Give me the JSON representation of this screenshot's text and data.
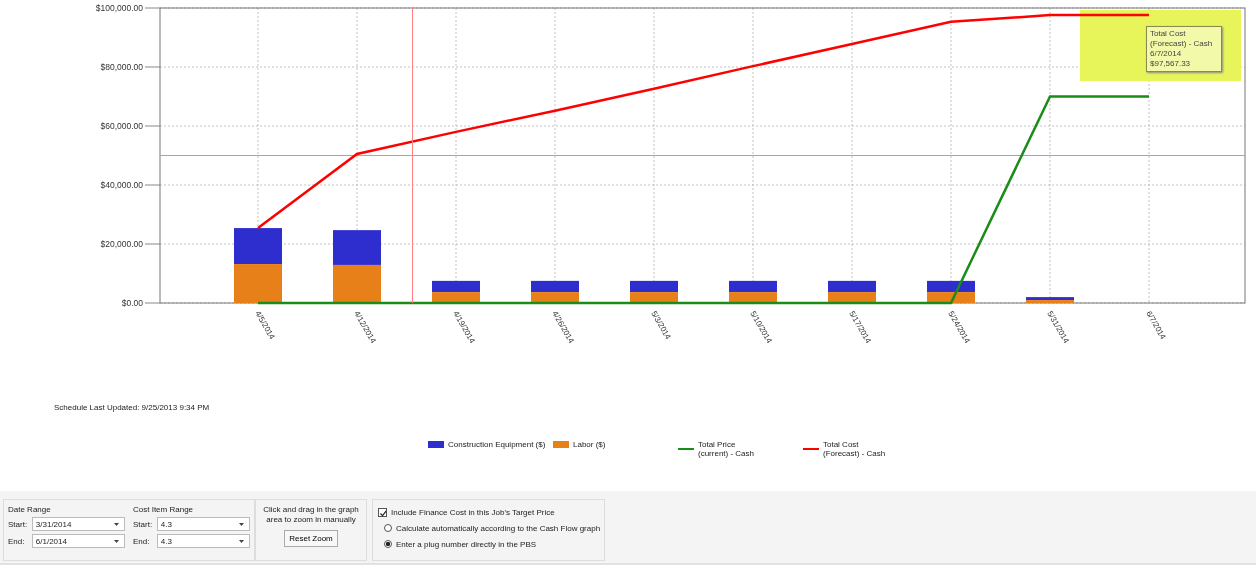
{
  "chart": {
    "chart_data": {
      "type": "bar",
      "stacked": true,
      "categories": [
        "4/5/2014",
        "4/12/2014",
        "4/19/2014",
        "4/26/2014",
        "5/3/2014",
        "5/10/2014",
        "5/17/2014",
        "5/24/2014",
        "5/31/2014",
        "6/7/2014"
      ],
      "ylim": [
        0,
        100000
      ],
      "yticks": [
        {
          "value": 0,
          "label": "$0.00"
        },
        {
          "value": 20000,
          "label": "$20,000.00"
        },
        {
          "value": 40000,
          "label": "$40,000.00"
        },
        {
          "value": 60000,
          "label": "$60,000.00"
        },
        {
          "value": 80000,
          "label": "$80,000.00"
        },
        {
          "value": 100000,
          "label": "$100,000.00"
        }
      ],
      "series": [
        {
          "name": "Construction Equipment ($)",
          "type": "bar",
          "color": "#2e2ecf",
          "values": [
            12200,
            11800,
            3800,
            3800,
            3800,
            3800,
            3800,
            3800,
            1000,
            0
          ]
        },
        {
          "name": "Labor ($)",
          "type": "bar",
          "color": "#e8801a",
          "values": [
            13200,
            12900,
            3700,
            3700,
            3700,
            3700,
            3700,
            3700,
            1000,
            0
          ]
        },
        {
          "name": "Total Price (current) - Cash",
          "type": "line",
          "color": "#1a8c1a",
          "values": [
            0,
            0,
            0,
            0,
            0,
            0,
            0,
            0,
            70000,
            70000
          ]
        },
        {
          "name": "Total Cost (Forecast) - Cash",
          "type": "line",
          "color": "#ff0000",
          "values": [
            25400,
            50500,
            58000,
            65200,
            72600,
            80300,
            87800,
            95300,
            97600,
            97600
          ]
        }
      ],
      "grid": true,
      "ref_lines": [
        {
          "axis": "y",
          "value": 50000
        }
      ]
    },
    "tooltip": {
      "series": "Total Cost (Forecast) - Cash",
      "date": "6/7/2014",
      "value": "$97,567.33"
    }
  },
  "schedule_updated": "Schedule Last Updated: 9/25/2013 9:34 PM",
  "controls": {
    "date_range": {
      "title": "Date Range",
      "start": {
        "label": "Start:",
        "value": "3/31/2014"
      },
      "end": {
        "label": "End:",
        "value": "6/1/2014"
      }
    },
    "cost_item_range": {
      "title": "Cost Item Range",
      "start": {
        "label": "Start:",
        "value": "4.3"
      },
      "end": {
        "label": "End:",
        "value": "4.3"
      }
    },
    "zoom": {
      "hint": "Click and drag in the graph area to zoom in manually",
      "button": "Reset Zoom"
    },
    "finance": {
      "checkbox": {
        "label": "Include Finance Cost in this Job's Target Price",
        "checked": true
      },
      "options": [
        {
          "label": "Calculate automatically according to the Cash Flow graph",
          "selected": false
        },
        {
          "label": "Enter a plug number directly in the PBS",
          "selected": true
        }
      ]
    }
  }
}
